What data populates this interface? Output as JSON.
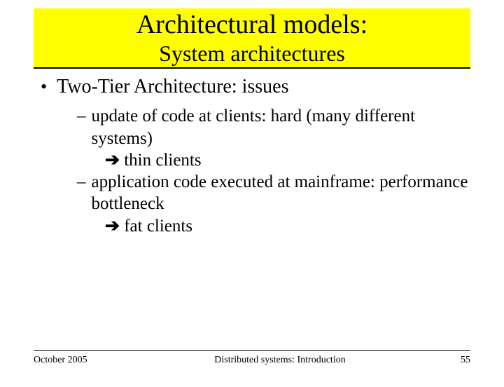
{
  "title": {
    "line1": "Architectural models:",
    "line2": "System architectures"
  },
  "bullet": "Two-Tier Architecture: issues",
  "sub1": {
    "text": "update of code at clients: hard (many different systems)",
    "arrow": "➔",
    "consequence": "thin clients"
  },
  "sub2": {
    "text": "application code executed at mainframe: performance bottleneck",
    "arrow": "➔",
    "consequence": "fat clients"
  },
  "footer": {
    "date": "October 2005",
    "center": "Distributed systems: Introduction",
    "page": "55"
  }
}
